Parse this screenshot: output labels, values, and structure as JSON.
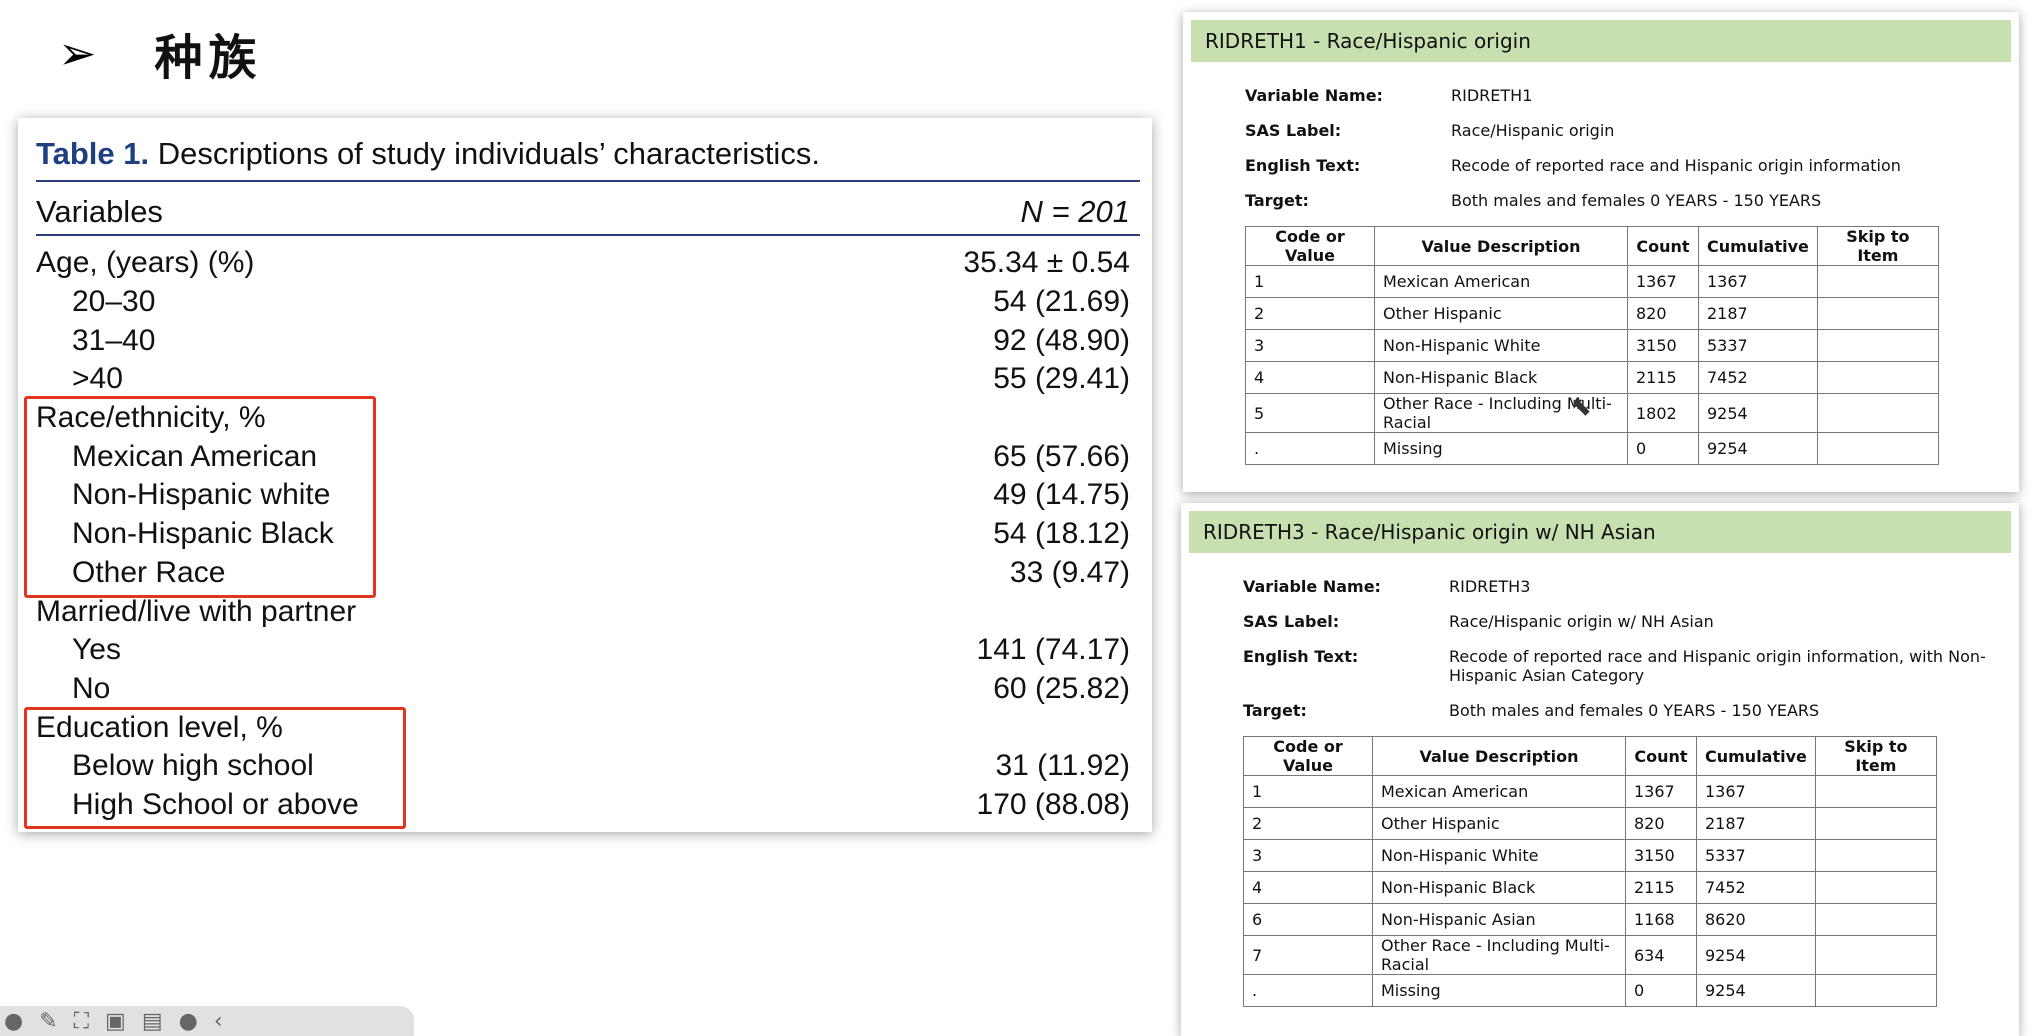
{
  "heading": {
    "bullet": "➢",
    "title": "种族"
  },
  "table1": {
    "caption_number": "Table 1.",
    "caption_text": "Descriptions of study individuals’ characteristics.",
    "col_variables": "Variables",
    "col_n": "N = 201",
    "rows": [
      {
        "label": "Age, (years) (%)",
        "value": "35.34 ± 0.54",
        "indent": false
      },
      {
        "label": "20–30",
        "value": "54 (21.69)",
        "indent": true
      },
      {
        "label": "31–40",
        "value": "92 (48.90)",
        "indent": true
      },
      {
        "label": ">40",
        "value": "55 (29.41)",
        "indent": true
      },
      {
        "label": "Race/ethnicity, %",
        "value": "",
        "indent": false
      },
      {
        "label": "Mexican American",
        "value": "65 (57.66)",
        "indent": true
      },
      {
        "label": "Non-Hispanic white",
        "value": "49 (14.75)",
        "indent": true
      },
      {
        "label": "Non-Hispanic Black",
        "value": "54 (18.12)",
        "indent": true
      },
      {
        "label": "Other Race",
        "value": "33 (9.47)",
        "indent": true
      },
      {
        "label": "Married/live with partner",
        "value": "",
        "indent": false
      },
      {
        "label": "Yes",
        "value": "141 (74.17)",
        "indent": true
      },
      {
        "label": "No",
        "value": "60 (25.82)",
        "indent": true
      },
      {
        "label": "Education level, %",
        "value": "",
        "indent": false
      },
      {
        "label": "Below high school",
        "value": "31 (11.92)",
        "indent": true
      },
      {
        "label": "High School or above",
        "value": "170 (88.08)",
        "indent": true
      }
    ]
  },
  "panel1": {
    "title": "RIDRETH1 - Race/Hispanic origin",
    "meta": [
      {
        "key": "Variable Name:",
        "val": "RIDRETH1"
      },
      {
        "key": "SAS Label:",
        "val": "Race/Hispanic origin"
      },
      {
        "key": "English Text:",
        "val": "Recode of reported race and Hispanic origin information"
      },
      {
        "key": "Target:",
        "val": "Both males and females 0 YEARS - 150 YEARS"
      }
    ],
    "headers": [
      "Code or Value",
      "Value Description",
      "Count",
      "Cumulative",
      "Skip to Item"
    ],
    "rows": [
      [
        "1",
        "Mexican American",
        "1367",
        "1367",
        ""
      ],
      [
        "2",
        "Other Hispanic",
        "820",
        "2187",
        ""
      ],
      [
        "3",
        "Non-Hispanic White",
        "3150",
        "5337",
        ""
      ],
      [
        "4",
        "Non-Hispanic Black",
        "2115",
        "7452",
        ""
      ],
      [
        "5",
        "Other Race - Including Multi-Racial",
        "1802",
        "9254",
        ""
      ],
      [
        ".",
        "Missing",
        "0",
        "9254",
        ""
      ]
    ]
  },
  "panel2": {
    "title": "RIDRETH3 - Race/Hispanic origin w/ NH Asian",
    "meta": [
      {
        "key": "Variable Name:",
        "val": "RIDRETH3"
      },
      {
        "key": "SAS Label:",
        "val": "Race/Hispanic origin w/ NH Asian"
      },
      {
        "key": "English Text:",
        "val": "Recode of reported race and Hispanic origin information, with Non-Hispanic Asian Category"
      },
      {
        "key": "Target:",
        "val": "Both males and females 0 YEARS - 150 YEARS"
      }
    ],
    "headers": [
      "Code or Value",
      "Value Description",
      "Count",
      "Cumulative",
      "Skip to Item"
    ],
    "rows": [
      [
        "1",
        "Mexican American",
        "1367",
        "1367",
        ""
      ],
      [
        "2",
        "Other Hispanic",
        "820",
        "2187",
        ""
      ],
      [
        "3",
        "Non-Hispanic White",
        "3150",
        "5337",
        ""
      ],
      [
        "4",
        "Non-Hispanic Black",
        "2115",
        "7452",
        ""
      ],
      [
        "6",
        "Non-Hispanic Asian",
        "1168",
        "8620",
        ""
      ],
      [
        "7",
        "Other Race - Including Multi-Racial",
        "634",
        "9254",
        ""
      ],
      [
        ".",
        "Missing",
        "0",
        "9254",
        ""
      ]
    ]
  },
  "toolbar": {
    "icons": [
      "record-icon",
      "pen-icon",
      "screenshot-icon",
      "camera-icon",
      "window-icon",
      "chat-icon",
      "back-icon"
    ]
  },
  "colors": {
    "accent_blue": "#1f3f83",
    "highlight_red": "#e2361f",
    "panel_header": "#c8dfb0"
  }
}
